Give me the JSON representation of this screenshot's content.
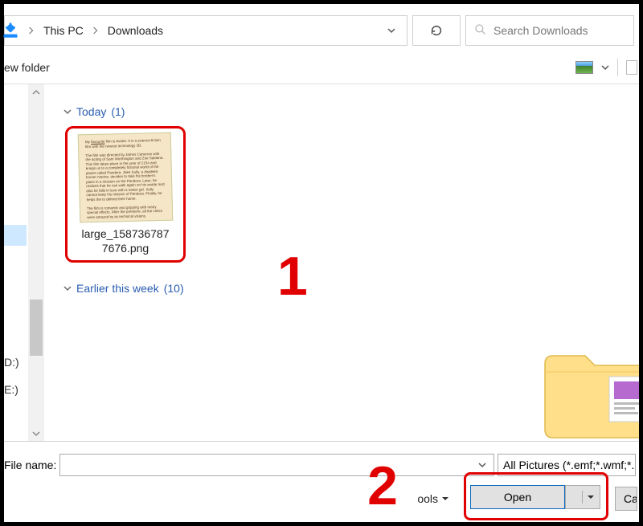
{
  "breadcrumb": {
    "items": [
      "This PC",
      "Downloads"
    ]
  },
  "search": {
    "placeholder": "Search Downloads"
  },
  "toolbar": {
    "new_folder": "ew folder"
  },
  "left_nav": {
    "selected_hint": "",
    "drive_d": "D:)",
    "drive_e": "E:)"
  },
  "main": {
    "groups": [
      {
        "name": "Today",
        "count": "(1)"
      },
      {
        "name": "Earlier this week",
        "count": "(10)"
      }
    ],
    "file": {
      "name": "large_158736787\n7676.png"
    }
  },
  "annotations": {
    "one": "1",
    "two": "2"
  },
  "bottom": {
    "filename_label": "File name:",
    "filename_value": "",
    "filter_label": "All Pictures (*.emf;*.wmf;*.",
    "tools_label": "ools",
    "open_label": "Open",
    "cancel_label": "Ca"
  }
}
